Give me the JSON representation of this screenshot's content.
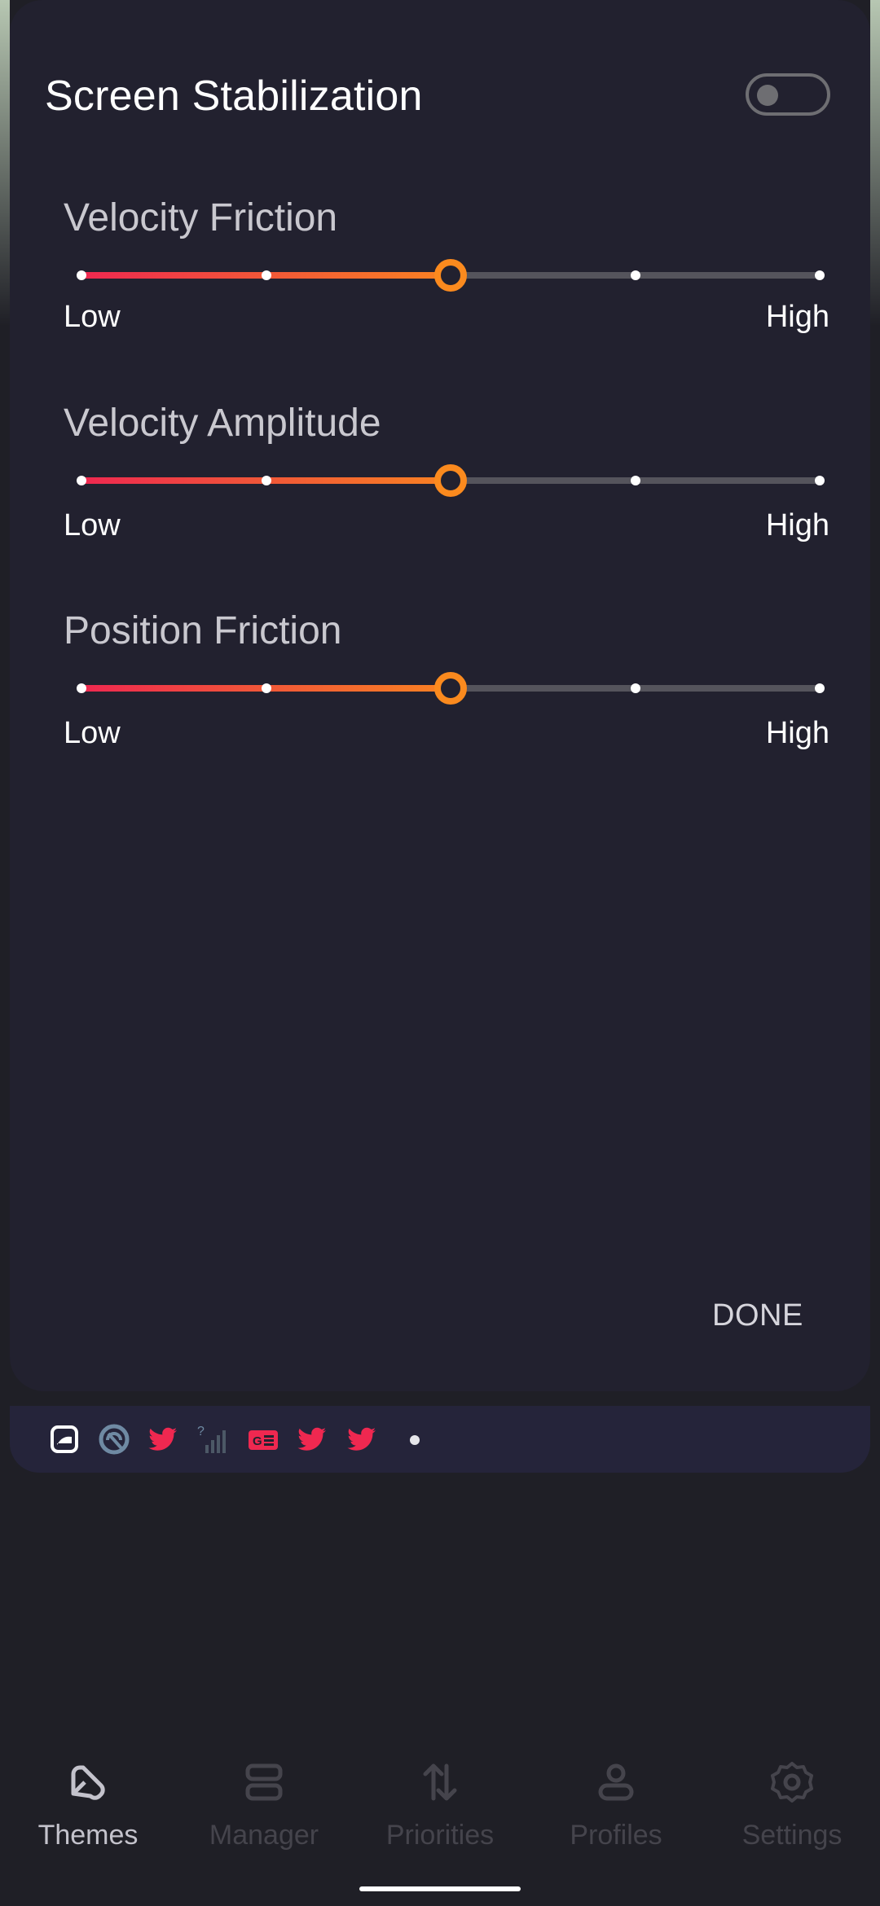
{
  "sheet": {
    "title": "Screen Stabilization",
    "toggle_on": false,
    "done_label": "DONE"
  },
  "settings": [
    {
      "title": "Velocity Friction",
      "low_label": "Low",
      "high_label": "High",
      "steps": 5,
      "value_index": 2
    },
    {
      "title": "Velocity Amplitude",
      "low_label": "Low",
      "high_label": "High",
      "steps": 5,
      "value_index": 2
    },
    {
      "title": "Position Friction",
      "low_label": "Low",
      "high_label": "High",
      "steps": 5,
      "value_index": 2
    }
  ],
  "notifications": {
    "icons": [
      "screenshot-app-icon",
      "android-circle-icon",
      "twitter-icon",
      "no-signal-icon",
      "news-app-icon",
      "twitter-icon",
      "twitter-icon"
    ],
    "accent": "#ef2850"
  },
  "nav": {
    "items": [
      {
        "label": "Themes",
        "icon": "themes-brush-icon",
        "active": true
      },
      {
        "label": "Manager",
        "icon": "manager-stack-icon",
        "active": false
      },
      {
        "label": "Priorities",
        "icon": "priorities-arrows-icon",
        "active": false
      },
      {
        "label": "Profiles",
        "icon": "profile-person-icon",
        "active": false
      },
      {
        "label": "Settings",
        "icon": "settings-gear-icon",
        "active": false
      }
    ]
  },
  "colors": {
    "sheet_bg": "#22212f",
    "track_start": "#ef2850",
    "track_end": "#f98222",
    "thumb": "#fb8a1e",
    "nav_active": "#c4c3cc",
    "nav_inactive": "#45444c"
  }
}
